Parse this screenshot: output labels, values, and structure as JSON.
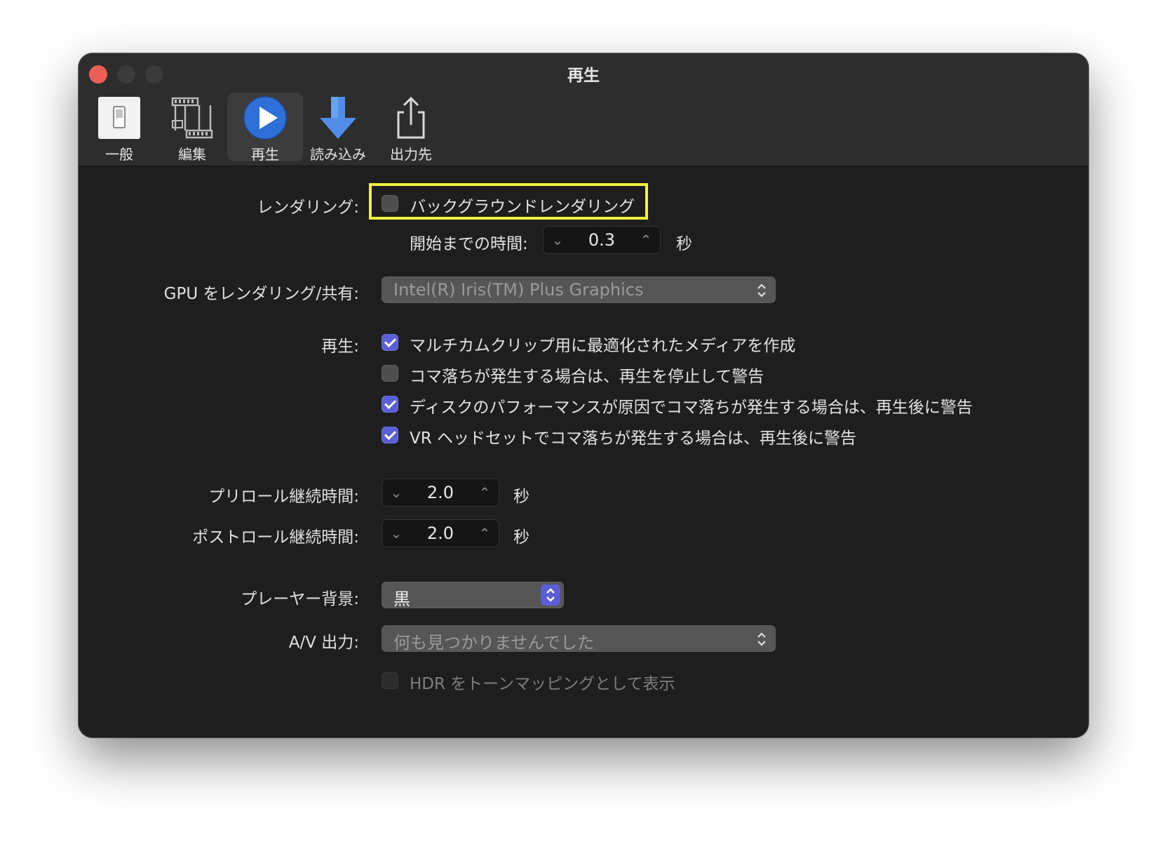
{
  "window": {
    "title": "再生"
  },
  "toolbar": {
    "items": [
      {
        "label": "一般",
        "icon": "general-switch-icon"
      },
      {
        "label": "編集",
        "icon": "film-strip-icon"
      },
      {
        "label": "再生",
        "icon": "play-icon",
        "selected": true
      },
      {
        "label": "読み込み",
        "icon": "download-arrow-icon"
      },
      {
        "label": "出力先",
        "icon": "share-icon"
      }
    ]
  },
  "rendering": {
    "label": "レンダリング:",
    "background_render_label": "バックグラウンドレンダリング",
    "background_render_checked": false,
    "start_delay_label": "開始までの時間:",
    "start_delay_value": "0.3",
    "start_delay_unit": "秒"
  },
  "gpu": {
    "label": "GPU をレンダリング/共有:",
    "selected": "Intel(R) Iris(TM) Plus Graphics"
  },
  "playback": {
    "label": "再生:",
    "options": [
      {
        "label": "マルチカムクリップ用に最適化されたメディアを作成",
        "checked": true
      },
      {
        "label": "コマ落ちが発生する場合は、再生を停止して警告",
        "checked": false
      },
      {
        "label": "ディスクのパフォーマンスが原因でコマ落ちが発生する場合は、再生後に警告",
        "checked": true
      },
      {
        "label": "VR ヘッドセットでコマ落ちが発生する場合は、再生後に警告",
        "checked": true
      }
    ]
  },
  "preroll": {
    "label": "プリロール継続時間:",
    "value": "2.0",
    "unit": "秒"
  },
  "postroll": {
    "label": "ポストロール継続時間:",
    "value": "2.0",
    "unit": "秒"
  },
  "player_background": {
    "label": "プレーヤー背景:",
    "selected": "黒"
  },
  "av_output": {
    "label": "A/V 出力:",
    "selected": "何も見つかりませんでした"
  },
  "hdr": {
    "label": "HDR をトーンマッピングとして表示",
    "checked": false,
    "enabled": false
  },
  "colors": {
    "accent": "#5a5fd6",
    "highlight": "#f3f03c",
    "close_button": "#ec5f57"
  }
}
